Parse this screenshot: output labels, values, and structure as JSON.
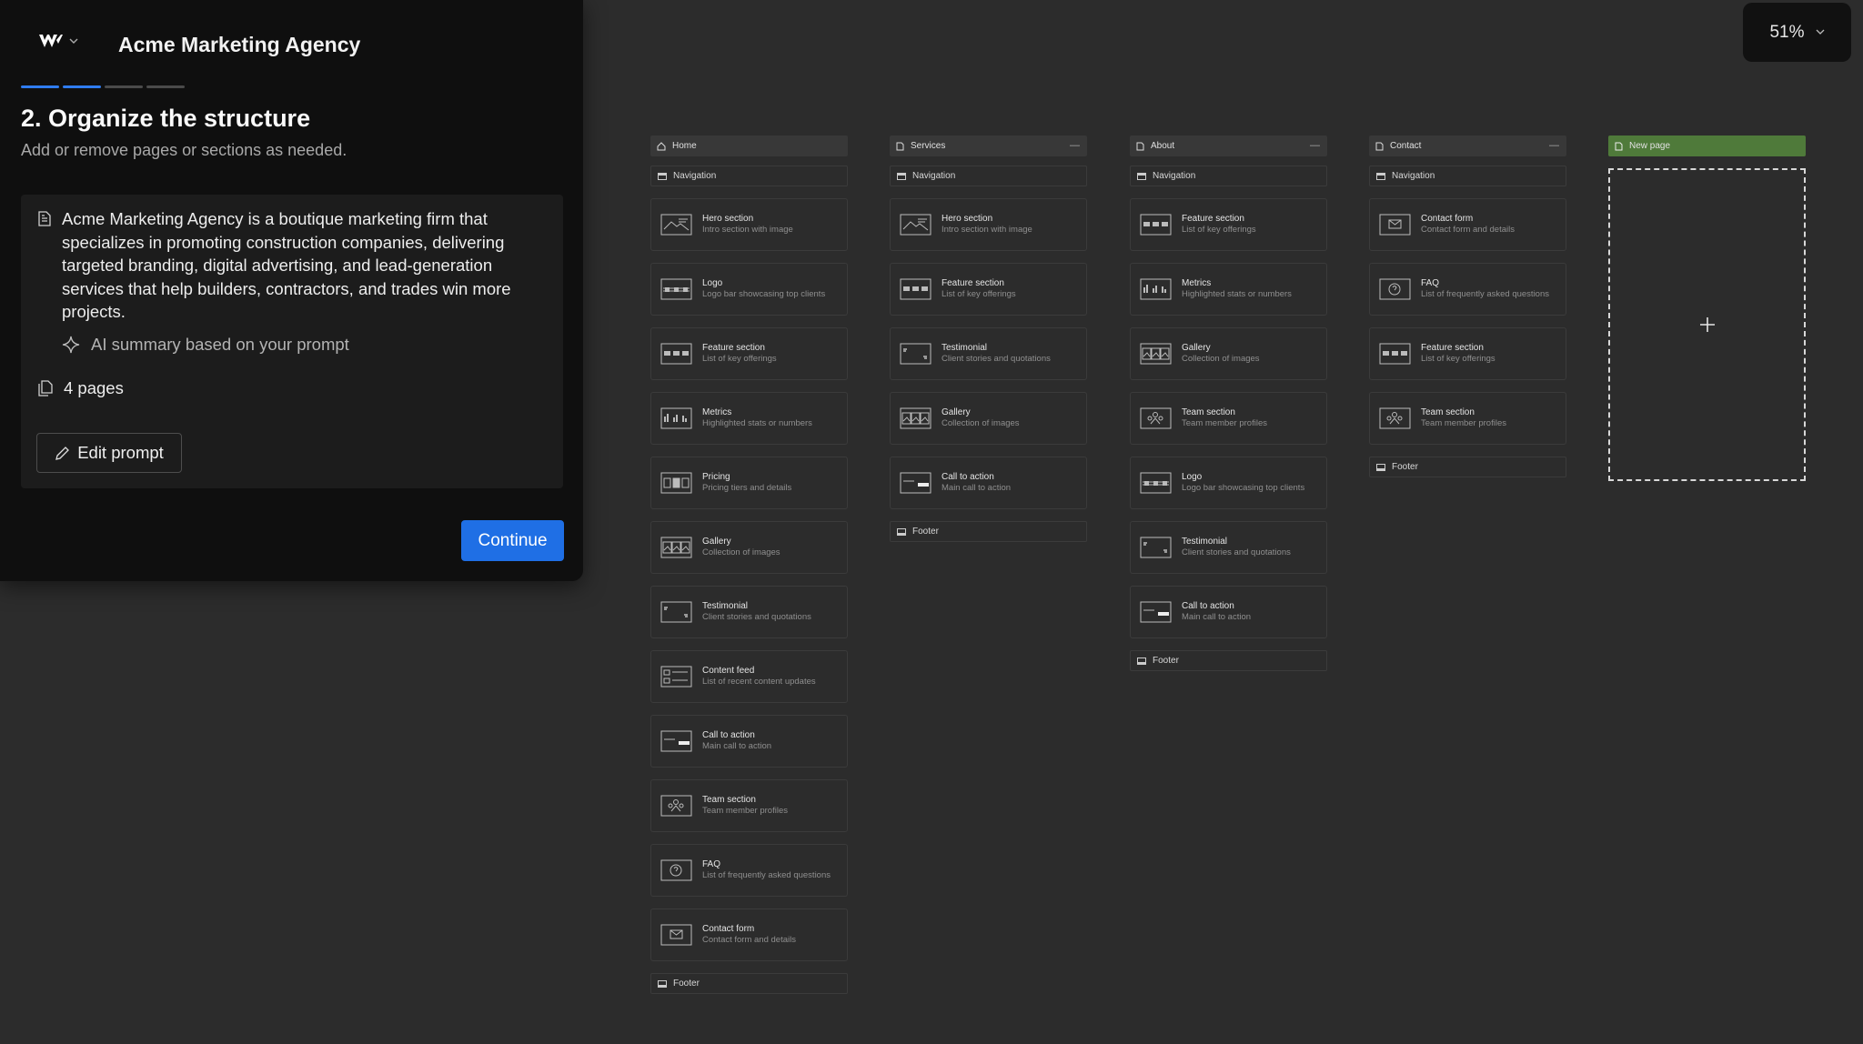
{
  "app": {
    "name": "Acme Marketing Agency"
  },
  "wizard": {
    "title": "2. Organize the structure",
    "subtitle": "Add or remove pages or sections as needed.",
    "summary": "Acme Marketing Agency is a boutique marketing firm that specializes in promoting construction companies, delivering targeted branding, digital advertising, and lead-generation services that help builders, contractors, and trades win more projects.",
    "ai_note": "AI summary based on your prompt",
    "pages_count": "4 pages",
    "edit_label": "Edit prompt",
    "continue_label": "Continue"
  },
  "zoom": {
    "value": "51%"
  },
  "pages": [
    {
      "name": "Home",
      "nav": "Navigation",
      "footer": "Footer",
      "sections": [
        {
          "name": "Hero section",
          "desc": "Intro section with image",
          "icon": "hero-icon"
        },
        {
          "name": "Logo",
          "desc": "Logo bar showcasing top clients",
          "icon": "logo-icon"
        },
        {
          "name": "Feature section",
          "desc": "List of key offerings",
          "icon": "feature-icon"
        },
        {
          "name": "Metrics",
          "desc": "Highlighted stats or numbers",
          "icon": "metrics-icon"
        },
        {
          "name": "Pricing",
          "desc": "Pricing tiers and details",
          "icon": "pricing-icon"
        },
        {
          "name": "Gallery",
          "desc": "Collection of images",
          "icon": "gallery-icon"
        },
        {
          "name": "Testimonial",
          "desc": "Client stories and quotations",
          "icon": "testimonial-icon"
        },
        {
          "name": "Content feed",
          "desc": "List of recent content updates",
          "icon": "feed-icon"
        },
        {
          "name": "Call to action",
          "desc": "Main call to action",
          "icon": "cta-icon"
        },
        {
          "name": "Team section",
          "desc": "Team member profiles",
          "icon": "team-icon"
        },
        {
          "name": "FAQ",
          "desc": "List of frequently asked questions",
          "icon": "faq-icon"
        },
        {
          "name": "Contact form",
          "desc": "Contact form and details",
          "icon": "contact-icon"
        }
      ]
    },
    {
      "name": "Services",
      "nav": "Navigation",
      "footer": "Footer",
      "sections": [
        {
          "name": "Hero section",
          "desc": "Intro section with image",
          "icon": "hero-icon"
        },
        {
          "name": "Feature section",
          "desc": "List of key offerings",
          "icon": "feature-icon"
        },
        {
          "name": "Testimonial",
          "desc": "Client stories and quotations",
          "icon": "testimonial-icon"
        },
        {
          "name": "Gallery",
          "desc": "Collection of images",
          "icon": "gallery-icon"
        },
        {
          "name": "Call to action",
          "desc": "Main call to action",
          "icon": "cta-icon"
        }
      ]
    },
    {
      "name": "About",
      "nav": "Navigation",
      "footer": "Footer",
      "sections": [
        {
          "name": "Feature section",
          "desc": "List of key offerings",
          "icon": "feature-icon"
        },
        {
          "name": "Metrics",
          "desc": "Highlighted stats or numbers",
          "icon": "metrics-icon"
        },
        {
          "name": "Gallery",
          "desc": "Collection of images",
          "icon": "gallery-icon"
        },
        {
          "name": "Team section",
          "desc": "Team member profiles",
          "icon": "team-icon"
        },
        {
          "name": "Logo",
          "desc": "Logo bar showcasing top clients",
          "icon": "logo-icon"
        },
        {
          "name": "Testimonial",
          "desc": "Client stories and quotations",
          "icon": "testimonial-icon"
        },
        {
          "name": "Call to action",
          "desc": "Main call to action",
          "icon": "cta-icon"
        }
      ]
    },
    {
      "name": "Contact",
      "nav": "Navigation",
      "footer": "Footer",
      "sections": [
        {
          "name": "Contact form",
          "desc": "Contact form and details",
          "icon": "contact-icon"
        },
        {
          "name": "FAQ",
          "desc": "List of frequently asked questions",
          "icon": "faq-icon"
        },
        {
          "name": "Feature section",
          "desc": "List of key offerings",
          "icon": "feature-icon"
        },
        {
          "name": "Team section",
          "desc": "Team member profiles",
          "icon": "team-icon"
        }
      ]
    }
  ],
  "new_page": {
    "label": "New page"
  },
  "colors": {
    "accent": "#1f6fe5",
    "new_page": "#4f7a3a",
    "canvas": "#2c2c2c",
    "panel": "#0f0f0f"
  }
}
